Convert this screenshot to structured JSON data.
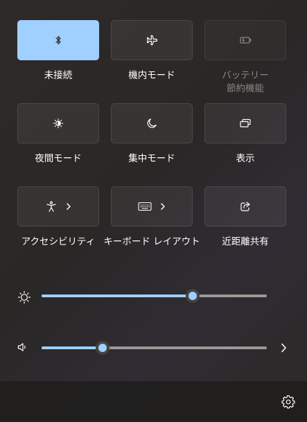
{
  "tiles": [
    {
      "id": "bluetooth",
      "label": "未接続",
      "icon": "bluetooth-icon",
      "state": "active"
    },
    {
      "id": "airplane",
      "label": "機内モード",
      "icon": "airplane-icon",
      "state": "off"
    },
    {
      "id": "battery-saver",
      "label": "バッテリー\n節約機能",
      "icon": "battery-saver-icon",
      "state": "disabled"
    },
    {
      "id": "night-light",
      "label": "夜間モード",
      "icon": "night-light-icon",
      "state": "off"
    },
    {
      "id": "focus",
      "label": "集中モード",
      "icon": "moon-icon",
      "state": "off"
    },
    {
      "id": "project",
      "label": "表示",
      "icon": "project-display-icon",
      "state": "off"
    },
    {
      "id": "accessibility",
      "label": "アクセシビリティ",
      "icon": "accessibility-icon",
      "state": "off",
      "chevron": true
    },
    {
      "id": "keyboard-layout",
      "label": "キーボード レイアウト",
      "icon": "keyboard-icon",
      "state": "off",
      "chevron": true
    },
    {
      "id": "nearby-share",
      "label": "近距離共有",
      "icon": "share-icon",
      "state": "off"
    }
  ],
  "brightness": {
    "icon": "brightness-icon",
    "value": 0.67
  },
  "volume": {
    "icon": "speaker-icon",
    "value": 0.27,
    "expand_icon": "chevron-right-icon"
  },
  "footer": {
    "settings_icon": "gear-icon"
  },
  "colors": {
    "accent": "#9fd0ff",
    "track": "#9b9896",
    "disabled_text": "#8a8784"
  }
}
